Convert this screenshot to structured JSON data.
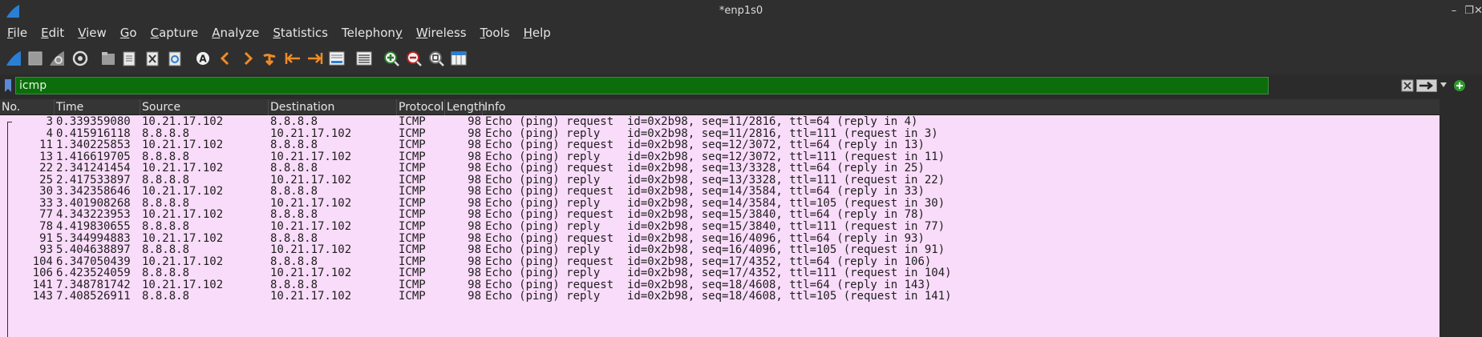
{
  "window": {
    "title": "*enp1s0",
    "controls": [
      "minimize",
      "restore",
      "close"
    ]
  },
  "menu": [
    {
      "label": "File",
      "key": "F",
      "rest": "ile"
    },
    {
      "label": "Edit",
      "key": "E",
      "rest": "dit"
    },
    {
      "label": "View",
      "key": "V",
      "rest": "iew"
    },
    {
      "label": "Go",
      "key": "G",
      "rest": "o"
    },
    {
      "label": "Capture",
      "key": "C",
      "rest": "apture"
    },
    {
      "label": "Analyze",
      "key": "A",
      "rest": "nalyze"
    },
    {
      "label": "Statistics",
      "key": "S",
      "rest": "tatistics"
    },
    {
      "label": "Telephony",
      "key": "y",
      "rest": "Telephon"
    },
    {
      "label": "Wireless",
      "key": "W",
      "rest": "ireless"
    },
    {
      "label": "Tools",
      "key": "T",
      "rest": "ools"
    },
    {
      "label": "Help",
      "key": "H",
      "rest": "elp"
    }
  ],
  "toolbar": {
    "icons": [
      "shark-fin-start-icon",
      "stop-square-icon",
      "restart-fin-icon",
      "options-gear-icon",
      "open-folder-icon",
      "save-file-icon",
      "close-file-icon",
      "reload-icon",
      "find-packet-icon",
      "go-back-icon",
      "go-forward-icon",
      "go-to-packet-icon",
      "first-packet-icon",
      "last-packet-icon",
      "autoscroll-icon",
      "colorize-icon",
      "zoom-in-icon",
      "zoom-out-icon",
      "normal-size-icon",
      "resize-columns-icon"
    ]
  },
  "filter": {
    "value": "icmp",
    "color": "#0b6e0b"
  },
  "columns": [
    "No.",
    "Time",
    "Source",
    "Destination",
    "Protocol",
    "Length",
    "Info"
  ],
  "packets": [
    {
      "no": "3",
      "time": "0.339359080",
      "src": "10.21.17.102",
      "dst": "8.8.8.8",
      "proto": "ICMP",
      "len": "98",
      "info": "Echo (ping) request  id=0x2b98, seq=11/2816, ttl=64 (reply in 4)"
    },
    {
      "no": "4",
      "time": "0.415916118",
      "src": "8.8.8.8",
      "dst": "10.21.17.102",
      "proto": "ICMP",
      "len": "98",
      "info": "Echo (ping) reply    id=0x2b98, seq=11/2816, ttl=111 (request in 3)"
    },
    {
      "no": "11",
      "time": "1.340225853",
      "src": "10.21.17.102",
      "dst": "8.8.8.8",
      "proto": "ICMP",
      "len": "98",
      "info": "Echo (ping) request  id=0x2b98, seq=12/3072, ttl=64 (reply in 13)"
    },
    {
      "no": "13",
      "time": "1.416619705",
      "src": "8.8.8.8",
      "dst": "10.21.17.102",
      "proto": "ICMP",
      "len": "98",
      "info": "Echo (ping) reply    id=0x2b98, seq=12/3072, ttl=111 (request in 11)"
    },
    {
      "no": "22",
      "time": "2.341241454",
      "src": "10.21.17.102",
      "dst": "8.8.8.8",
      "proto": "ICMP",
      "len": "98",
      "info": "Echo (ping) request  id=0x2b98, seq=13/3328, ttl=64 (reply in 25)"
    },
    {
      "no": "25",
      "time": "2.417533897",
      "src": "8.8.8.8",
      "dst": "10.21.17.102",
      "proto": "ICMP",
      "len": "98",
      "info": "Echo (ping) reply    id=0x2b98, seq=13/3328, ttl=111 (request in 22)"
    },
    {
      "no": "30",
      "time": "3.342358646",
      "src": "10.21.17.102",
      "dst": "8.8.8.8",
      "proto": "ICMP",
      "len": "98",
      "info": "Echo (ping) request  id=0x2b98, seq=14/3584, ttl=64 (reply in 33)"
    },
    {
      "no": "33",
      "time": "3.401908268",
      "src": "8.8.8.8",
      "dst": "10.21.17.102",
      "proto": "ICMP",
      "len": "98",
      "info": "Echo (ping) reply    id=0x2b98, seq=14/3584, ttl=105 (request in 30)"
    },
    {
      "no": "77",
      "time": "4.343223953",
      "src": "10.21.17.102",
      "dst": "8.8.8.8",
      "proto": "ICMP",
      "len": "98",
      "info": "Echo (ping) request  id=0x2b98, seq=15/3840, ttl=64 (reply in 78)"
    },
    {
      "no": "78",
      "time": "4.419830655",
      "src": "8.8.8.8",
      "dst": "10.21.17.102",
      "proto": "ICMP",
      "len": "98",
      "info": "Echo (ping) reply    id=0x2b98, seq=15/3840, ttl=111 (request in 77)"
    },
    {
      "no": "91",
      "time": "5.344994883",
      "src": "10.21.17.102",
      "dst": "8.8.8.8",
      "proto": "ICMP",
      "len": "98",
      "info": "Echo (ping) request  id=0x2b98, seq=16/4096, ttl=64 (reply in 93)"
    },
    {
      "no": "93",
      "time": "5.404638897",
      "src": "8.8.8.8",
      "dst": "10.21.17.102",
      "proto": "ICMP",
      "len": "98",
      "info": "Echo (ping) reply    id=0x2b98, seq=16/4096, ttl=105 (request in 91)"
    },
    {
      "no": "104",
      "time": "6.347050439",
      "src": "10.21.17.102",
      "dst": "8.8.8.8",
      "proto": "ICMP",
      "len": "98",
      "info": "Echo (ping) request  id=0x2b98, seq=17/4352, ttl=64 (reply in 106)"
    },
    {
      "no": "106",
      "time": "6.423524059",
      "src": "8.8.8.8",
      "dst": "10.21.17.102",
      "proto": "ICMP",
      "len": "98",
      "info": "Echo (ping) reply    id=0x2b98, seq=17/4352, ttl=111 (request in 104)"
    },
    {
      "no": "141",
      "time": "7.348781742",
      "src": "10.21.17.102",
      "dst": "8.8.8.8",
      "proto": "ICMP",
      "len": "98",
      "info": "Echo (ping) request  id=0x2b98, seq=18/4608, ttl=64 (reply in 143)"
    },
    {
      "no": "143",
      "time": "7.408526911",
      "src": "8.8.8.8",
      "dst": "10.21.17.102",
      "proto": "ICMP",
      "len": "98",
      "info": "Echo (ping) reply    id=0x2b98, seq=18/4608, ttl=105 (request in 141)"
    }
  ],
  "colors": {
    "row_bg": "#f9dcf9",
    "chrome_bg": "#2f2f2f",
    "filter_bg": "#0b6e0b"
  }
}
